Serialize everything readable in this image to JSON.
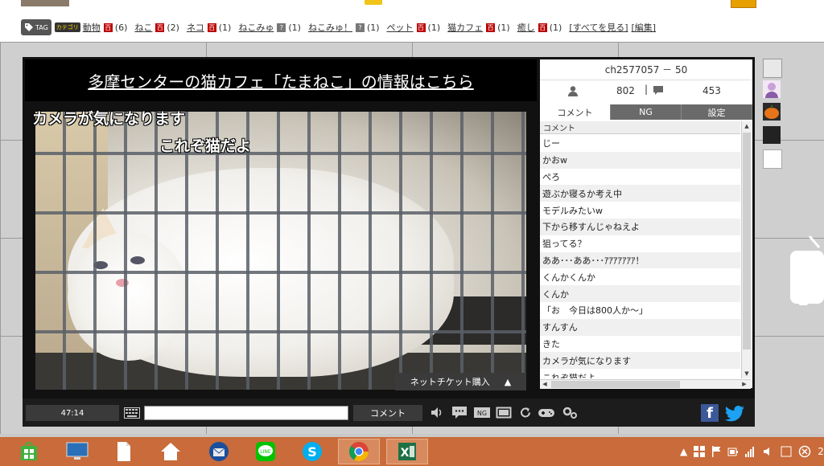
{
  "tags": {
    "logo_label": "TAG",
    "category_label": "カテゴリ",
    "items": [
      {
        "name": "動物",
        "count": "(6)",
        "dic": "百"
      },
      {
        "name": "ねこ",
        "count": "(2)",
        "dic": "百"
      },
      {
        "name": "ネコ",
        "count": "(1)",
        "dic": "百"
      },
      {
        "name": "ねこみゅ",
        "count": "(1)",
        "dic": "?"
      },
      {
        "name": "ねこみゅ！",
        "count": "(1)",
        "dic": "?"
      },
      {
        "name": "ペット",
        "count": "(1)",
        "dic": "百"
      },
      {
        "name": "猫カフェ",
        "count": "(1)",
        "dic": "百"
      },
      {
        "name": "癒し",
        "count": "(1)",
        "dic": "百"
      }
    ],
    "see_all": "[すべてを見る]",
    "edit": "[編集]"
  },
  "player": {
    "banner": "多摩センターの猫カフェ「たまねこ」の情報はこちら",
    "overlay_comments": [
      "カメラが気になります",
      "これぞ猫だよ"
    ],
    "ticket_button": "ネットチケット購入",
    "ticket_arrow": "▲"
  },
  "panel": {
    "channel": "ch2577057 － 50",
    "viewers": "802",
    "separator": "|",
    "comment_count": "453",
    "tabs": [
      "コメント",
      "NG",
      "設定"
    ],
    "active_tab": "コメント",
    "list_header": "コメント",
    "comments": [
      "じー",
      "かおw",
      "ぺろ",
      "遊ぶか寝るか考え中",
      "モデルみたいw",
      "下から移すんじゃねえよ",
      "狙ってる？",
      "ああ･･･ああ･･･ｱｱｱｱｱｱｱ！",
      "くんかくんか",
      "くんか",
      "「お　今日は800人か～」",
      "すんすん",
      "きた",
      "カメラが気になります",
      "これぞ猫だよ"
    ]
  },
  "controls": {
    "time": "47:14",
    "comment_button": "コメント",
    "comment_placeholder": ""
  },
  "colors": {
    "taskbar": "#c96b3a",
    "player_bg": "#111111",
    "facebook": "#3b5998",
    "twitter": "#1da1f2",
    "highlight_chip": "#e8a000"
  },
  "taskbar": {
    "apps": [
      "store-icon",
      "computer-icon",
      "document-icon",
      "home-icon",
      "thunderbird-icon",
      "line-icon",
      "skype-icon",
      "chrome-icon",
      "excel-icon"
    ],
    "tray_partial": "2"
  }
}
